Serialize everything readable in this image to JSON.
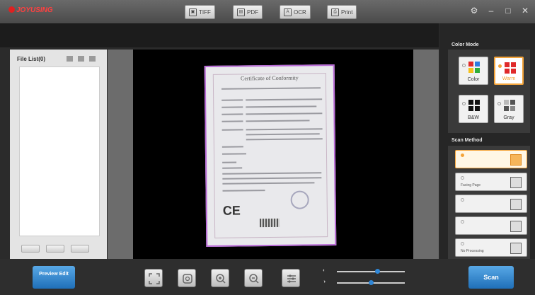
{
  "app": {
    "brand": "JOYUSING"
  },
  "window": {
    "settings_icon": "gear-icon",
    "minimize_icon": "minimize-icon",
    "maximize_icon": "maximize-icon",
    "close_icon": "close-icon"
  },
  "toolbar": {
    "buttons": [
      {
        "label": "TIFF",
        "icon": "image-icon"
      },
      {
        "label": "PDF",
        "icon": "pdf-icon"
      },
      {
        "label": "OCR",
        "icon": "ocr-icon"
      },
      {
        "label": "Print",
        "icon": "printer-icon"
      }
    ]
  },
  "file_list": {
    "title": "File List(0)"
  },
  "preview": {
    "document_heading": "Certificate of Conformity",
    "ce_mark": "CE"
  },
  "bottom": {
    "preview_edit_label": "Preview Edit",
    "scan_label": "Scan",
    "tools": [
      "fit-screen-icon",
      "rotate-icon",
      "zoom-in-icon",
      "zoom-out-icon",
      "adjust-icon"
    ],
    "sliders": [
      {
        "value": 0.6
      },
      {
        "value": 0.5
      }
    ]
  },
  "color_mode": {
    "title": "Color Mode",
    "options": [
      {
        "label": "Color",
        "selected": false
      },
      {
        "label": "Warm",
        "selected": true
      },
      {
        "label": "B&W",
        "selected": false
      },
      {
        "label": "Gray",
        "selected": false
      }
    ]
  },
  "scan_method": {
    "title": "Scan Method",
    "options": [
      {
        "label": "",
        "selected": true
      },
      {
        "label": "Facing Page",
        "selected": false
      },
      {
        "label": "",
        "selected": false
      },
      {
        "label": "",
        "selected": false
      },
      {
        "label": "No Processing",
        "selected": false
      }
    ]
  },
  "colors": {
    "accent": "#f4a43a",
    "primary_button": "#2f86d6",
    "crop_frame": "#b86ad6"
  }
}
